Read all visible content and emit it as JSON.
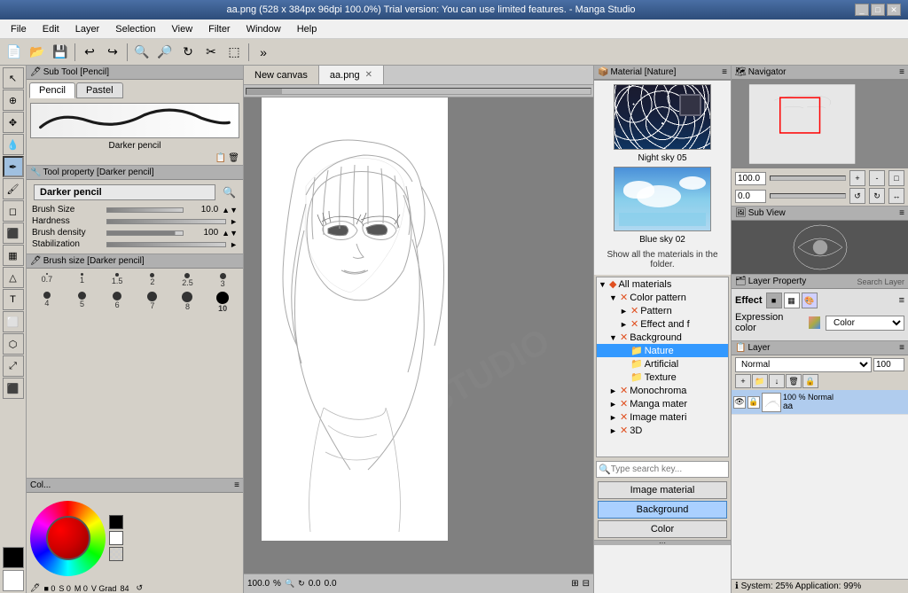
{
  "window": {
    "title": "aa.png (528 x 384px 96dpi 100.0%)  Trial version: You can use limited features. - Manga Studio",
    "controls": [
      "_",
      "□",
      "✕"
    ]
  },
  "menu": {
    "items": [
      "File",
      "Edit",
      "Layer",
      "Selection",
      "View",
      "Filter",
      "Window",
      "Help"
    ]
  },
  "toolbar": {
    "buttons": [
      "new",
      "open",
      "save",
      "undo",
      "redo",
      "zoom-in",
      "zoom-out",
      "rotate"
    ]
  },
  "left_tools": {
    "items": [
      "cursor",
      "move",
      "zoom",
      "eyedropper",
      "pen",
      "brush",
      "eraser",
      "fill",
      "text",
      "shape",
      "select-rect",
      "select-lasso",
      "transform",
      "layer-move"
    ]
  },
  "sub_tool": {
    "header": "Sub Tool [Pencil]",
    "tabs": [
      "Pencil",
      "Pastel"
    ],
    "active_tab": "Pencil",
    "selected_tool": "Darker pencil"
  },
  "tool_property": {
    "header": "Tool property [Darker pencil]",
    "title": "Darker pencil",
    "brush_size_label": "Brush Size",
    "brush_size_value": "10.0",
    "hardness_label": "Hardness",
    "brush_density_label": "Brush density",
    "brush_density_value": "100",
    "stabilization_label": "Stabilization"
  },
  "brush_sizes": {
    "header": "Brush size [Darker pencil]",
    "items": [
      {
        "label": "0.7",
        "size": 2
      },
      {
        "label": "1",
        "size": 3
      },
      {
        "label": "1.5",
        "size": 4
      },
      {
        "label": "2",
        "size": 5
      },
      {
        "label": "2.5",
        "size": 6
      },
      {
        "label": "3",
        "size": 7
      },
      {
        "label": "4",
        "size": 8
      },
      {
        "label": "5",
        "size": 9
      },
      {
        "label": "6",
        "size": 10
      },
      {
        "label": "7",
        "size": 11
      },
      {
        "label": "8",
        "size": 12
      },
      {
        "label": "10",
        "size": 14,
        "selected": true
      }
    ]
  },
  "color_panel": {
    "header": "Col...",
    "foreground": "#000000",
    "background": "#ffffff"
  },
  "canvas": {
    "tabs": [
      {
        "label": "New canvas",
        "active": false
      },
      {
        "label": "aa.png",
        "active": true,
        "closeable": true
      }
    ],
    "zoom": "100.0",
    "coords": "0.0",
    "status": "0 S 0 M 0 Grad 84"
  },
  "material": {
    "header": "Material [Nature]",
    "tree": [
      {
        "label": "All materials",
        "level": 0,
        "expanded": true,
        "icon": "▼"
      },
      {
        "label": "Color pattern",
        "level": 1,
        "expanded": true,
        "icon": "▼",
        "type": "x"
      },
      {
        "label": "Pattern",
        "level": 2,
        "expanded": false,
        "icon": "►",
        "type": "x"
      },
      {
        "label": "Effect and f",
        "level": 2,
        "expanded": false,
        "icon": "►",
        "type": "x"
      },
      {
        "label": "Background",
        "level": 1,
        "expanded": true,
        "icon": "▼",
        "type": "x"
      },
      {
        "label": "Nature",
        "level": 2,
        "expanded": false,
        "icon": "",
        "selected": true
      },
      {
        "label": "Artificial",
        "level": 2,
        "expanded": false,
        "icon": ""
      },
      {
        "label": "Texture",
        "level": 2,
        "expanded": false,
        "icon": ""
      },
      {
        "label": "Monochroma",
        "level": 1,
        "expanded": false,
        "icon": "►",
        "type": "x"
      },
      {
        "label": "Manga mater",
        "level": 1,
        "expanded": false,
        "icon": "►",
        "type": "x"
      },
      {
        "label": "Image materi",
        "level": 1,
        "expanded": false,
        "icon": "►",
        "type": "x"
      },
      {
        "label": "3D",
        "level": 1,
        "expanded": false,
        "icon": "►",
        "type": "x"
      }
    ],
    "search_placeholder": "Type search key...",
    "buttons": [
      "Image material",
      "Background",
      "Color"
    ],
    "active_button": "Background",
    "preview": {
      "items": [
        {
          "label": "Night sky 05"
        },
        {
          "label": "Blue sky 02"
        }
      ],
      "show_all_text": "Show all the materials in the folder."
    }
  },
  "navigator": {
    "header": "Navigator",
    "zoom_value": "100.0",
    "rotation_value": "0.0"
  },
  "sub_view": {
    "header": "Sub View"
  },
  "layer_property": {
    "header": "Layer Property",
    "search_label": "Search Layer",
    "effect_label": "Effect",
    "expression_color_label": "Expression color",
    "color_label": "Color",
    "effect_options": [
      "black",
      "pattern",
      "color"
    ],
    "color_options": [
      "Color"
    ]
  },
  "layer": {
    "header": "Layer",
    "mode": "Normal",
    "opacity": "100",
    "layer_items": [
      {
        "name": "aa",
        "mode": "Normal",
        "opacity": "100 %",
        "visible": true
      }
    ]
  },
  "info_panel": {
    "text": "System: 25%  Application: 99%"
  },
  "status": {
    "brush_size": "0",
    "s": "0",
    "m": "0",
    "grad": "84",
    "zoom": "100.0",
    "x": "0.0",
    "y": "0.0"
  }
}
